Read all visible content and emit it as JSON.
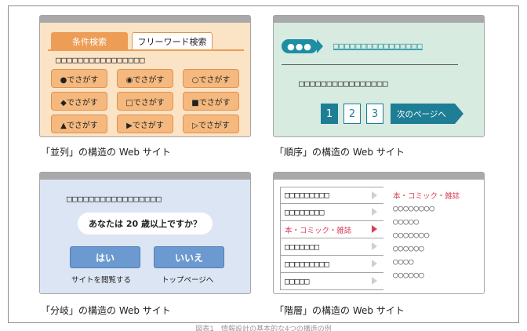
{
  "panels": {
    "parallel": {
      "tabs": [
        "条件検索",
        "フリーワード検索"
      ],
      "title_boxes": "□□□□□□□□□□□□□□□□",
      "options": [
        "●でさがす",
        "◉でさがす",
        "○でさがす",
        "◆でさがす",
        "□でさがす",
        "■でさがす",
        "▲でさがす",
        "▶でさがす",
        "▷でさがす"
      ],
      "caption": "「並列」の構造の Web サイト"
    },
    "sequence": {
      "pill": "●●●",
      "link_boxes": "□□□□□□□□□□□□□□□□",
      "body_boxes": "□□□□□□□□□□□□□□□□",
      "pages": [
        "1",
        "2",
        "3"
      ],
      "next": "次のページへ",
      "caption": "「順序」の構造の Web サイト"
    },
    "branch": {
      "title_boxes": "□□□□□□□□□□□□□□□□□",
      "question": "あなたは 20 歳以上ですか？",
      "yes": "はい",
      "yes_sub": "サイトを閲覧する",
      "no": "いいえ",
      "no_sub": "トップページへ",
      "caption": "「分岐」の構造の Web サイト"
    },
    "hierarchy": {
      "menu": [
        "□□□□□□□□□",
        "□□□□□□□□",
        "本・コミック・雑誌",
        "□□□□□□□",
        "□□□□□□□□□",
        "□□□□□"
      ],
      "sub_title": "本・コミック・雑誌",
      "sub_items": [
        "○○○○○○○○",
        "○○○○○",
        "○○○○○○○",
        "○○○○○○",
        "○○○○",
        "○○○○○○"
      ],
      "caption": "「階層」の構造の Web サイト"
    }
  },
  "colors": {
    "parallel_bg": "#fbe3c6",
    "parallel_accent": "#ed9d55",
    "sequence_bg": "#d8ebe0",
    "sequence_accent": "#1d7e96",
    "branch_bg": "#dce5f3",
    "branch_button": "#6c9ad0",
    "hierarchy_highlight": "#d8405a"
  },
  "footer": "図表1　情報設計の基本的な4つの構造の例"
}
